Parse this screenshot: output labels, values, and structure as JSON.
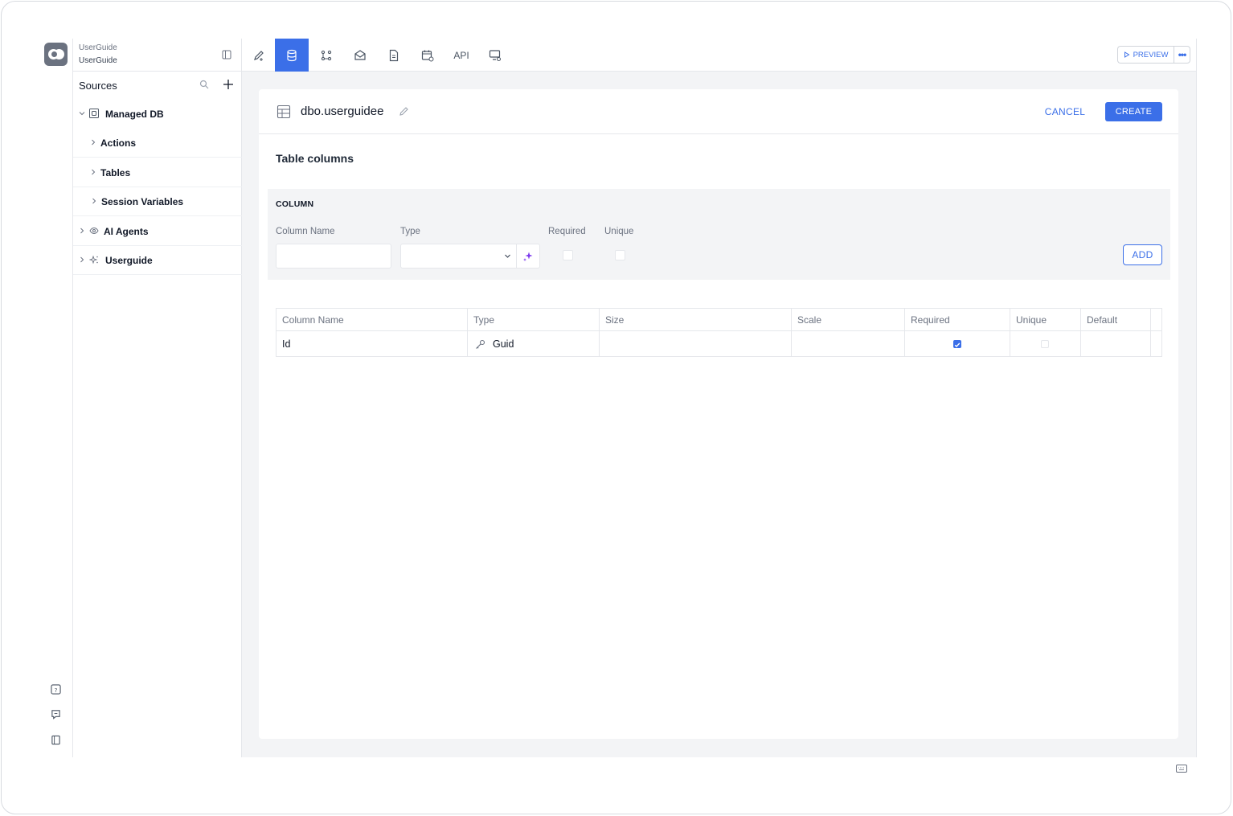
{
  "project": {
    "label": "UserGuide",
    "name": "UserGuide"
  },
  "sidebar": {
    "title": "Sources",
    "tree": [
      {
        "label": "Managed DB",
        "icon": "database-box-icon",
        "expanded": true
      },
      {
        "label": "Actions"
      },
      {
        "label": "Tables"
      },
      {
        "label": "Session Variables"
      },
      {
        "label": "AI Agents",
        "icon": "eye-icon"
      },
      {
        "label": "Userguide",
        "icon": "sparkle-icon"
      }
    ]
  },
  "toolbar": {
    "tabs": [
      "design-icon",
      "database-icon",
      "workflow-icon",
      "mail-icon",
      "document-icon",
      "calendar-icon",
      "API",
      "monitor-settings-icon"
    ],
    "api_label": "API",
    "active_tab": "database-icon",
    "preview_label": "PREVIEW",
    "more_label": "•••"
  },
  "editor": {
    "table_name": "dbo.userguidee",
    "cancel_label": "CANCEL",
    "create_label": "CREATE",
    "section_title": "Table columns",
    "column_form": {
      "heading": "COLUMN",
      "name_label": "Column Name",
      "type_label": "Type",
      "required_label": "Required",
      "unique_label": "Unique",
      "name_value": "",
      "type_value": "",
      "add_label": "ADD"
    },
    "grid": {
      "headers": [
        "Column Name",
        "Type",
        "Size",
        "Scale",
        "Required",
        "Unique",
        "Default"
      ],
      "rows": [
        {
          "name": "Id",
          "type": "Guid",
          "size": "",
          "scale": "",
          "required": true,
          "unique": false,
          "default": ""
        }
      ]
    }
  },
  "colors": {
    "accent": "#3b6fe8",
    "magic": "#7c3aed"
  }
}
